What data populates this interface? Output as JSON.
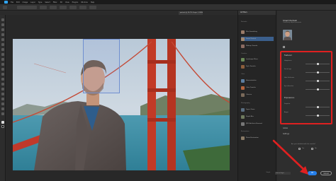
{
  "app": {
    "name": "Adobe Photoshop",
    "logo_label": "Ps"
  },
  "menu": [
    "File",
    "Edit",
    "Image",
    "Layer",
    "Type",
    "Select",
    "Filter",
    "3D",
    "View",
    "Plugins",
    "Window",
    "Help"
  ],
  "document_tab": {
    "label": "portrait @ 16.7% (Layer 1, RGB/8)"
  },
  "neural_filters": {
    "header": "Neural Filters",
    "list_header": "All filters",
    "sections": [
      "Portraits",
      "Creative",
      "Color",
      "Photography",
      "Restoration"
    ],
    "filters": [
      {
        "label": "Skin Smoothing",
        "color": "#9a7b68"
      },
      {
        "label": "Smart Portrait",
        "color": "#a08770",
        "active": true
      },
      {
        "label": "Makeup Transfer",
        "color": "#8c6c62"
      },
      {
        "label": "Landscape Mixer",
        "color": "#6b8a58"
      },
      {
        "label": "Style Transfer",
        "color": "#8c5e3c"
      },
      {
        "label": "Harmonization",
        "color": "#5d7ea0"
      },
      {
        "label": "Color Transfer",
        "color": "#b3643d"
      },
      {
        "label": "Colorize",
        "color": "#7a6a5a"
      },
      {
        "label": "Super Zoom",
        "color": "#5a6d80"
      },
      {
        "label": "Depth Blur",
        "color": "#6f7a5e"
      },
      {
        "label": "JPEG Artifacts Removal",
        "color": "#777777"
      },
      {
        "label": "Photo Restoration",
        "color": "#8a7a66"
      }
    ]
  },
  "settings": {
    "title": "Smart Portrait",
    "subtitle": "Creatively adjust portraits",
    "group_featured": "Featured",
    "featured_sliders": [
      {
        "label": "Happiness",
        "value": 0.5
      },
      {
        "label": "Facial age",
        "value": 0.5
      },
      {
        "label": "Hair thickness",
        "value": 0.5
      },
      {
        "label": "Eye direction",
        "value": 0.5
      }
    ],
    "group_expressions": "Expressions",
    "expression_sliders": [
      {
        "label": "Surprise",
        "value": 0.5
      },
      {
        "label": "Anger",
        "value": 0.5
      }
    ],
    "group_global": "Global",
    "group_settings": "Settings",
    "feedback_question": "Are you satisfied with the results?",
    "feedback_yes": "Yes",
    "feedback_no": "No",
    "output_label": "Output",
    "output_value": "Current layer",
    "ok_label": "OK",
    "cancel_label": "Cancel"
  },
  "colors": {
    "accent": "#2680eb",
    "highlight_box": "#e02020",
    "arrow": "#e02020"
  }
}
